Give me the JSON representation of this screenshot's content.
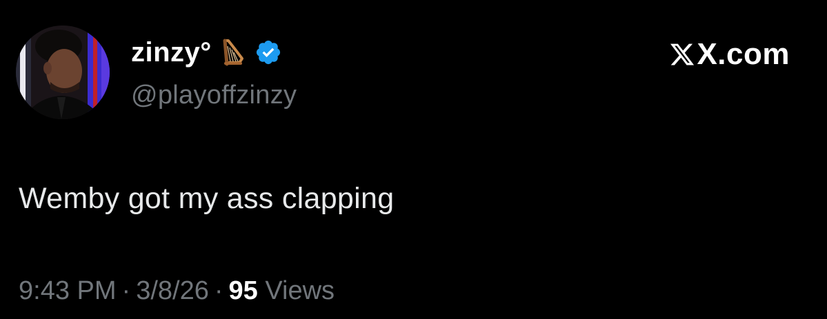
{
  "author": {
    "display_name": "zinzy°",
    "handle": "@playoffzinzy",
    "badge_emoji": "harp-icon",
    "verified": true
  },
  "brand": {
    "domain": "X.com",
    "icon": "x-logo-icon"
  },
  "tweet": {
    "text": "Wemby got my ass clapping"
  },
  "meta": {
    "time": "9:43 PM",
    "separator": "·",
    "date": "3/8/26",
    "views_count": "95",
    "views_label": "Views"
  },
  "colors": {
    "background": "#000000",
    "primary_text": "#e7e9ea",
    "secondary_text": "#71767b",
    "verified_blue": "#1d9bf0"
  }
}
